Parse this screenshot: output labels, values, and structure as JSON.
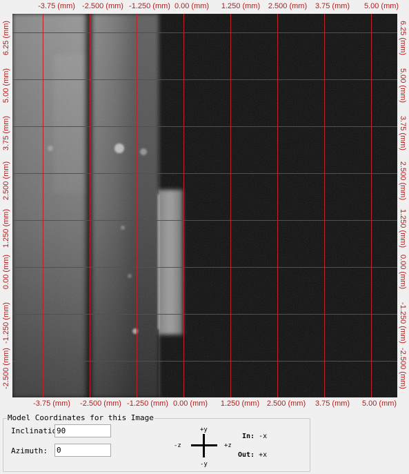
{
  "x_ticks": [
    "-3.75 (mm)",
    "-2.500 (mm)",
    "-1.250 (mm)",
    "0.00 (mm)",
    "1.250 (mm)",
    "2.500 (mm)",
    "3.75 (mm)",
    "5.00 (mm)"
  ],
  "y_ticks": [
    "6.25 (mm)",
    "5.00 (mm)",
    "3.75 (mm)",
    "2.500 (mm)",
    "1.250 (mm)",
    "0.00 (mm)",
    "-1.250 (mm)",
    "-2.500 (mm)"
  ],
  "colors": {
    "grid": "#c0202a",
    "tick_text": "#b51a1a",
    "image_bg": "#0a0a0a"
  },
  "model_coords": {
    "title": "Model Coordinates for this Image",
    "inclination_label": "Inclination:",
    "inclination_value": "90",
    "azimuth_label": "Azimuth:",
    "azimuth_value": "0"
  },
  "axes": {
    "up": "+y",
    "down": "-y",
    "left": "-z",
    "right": "+z"
  },
  "view": {
    "in_label": "In:",
    "in_value": "-x",
    "out_label": "Out:",
    "out_value": "+x"
  }
}
